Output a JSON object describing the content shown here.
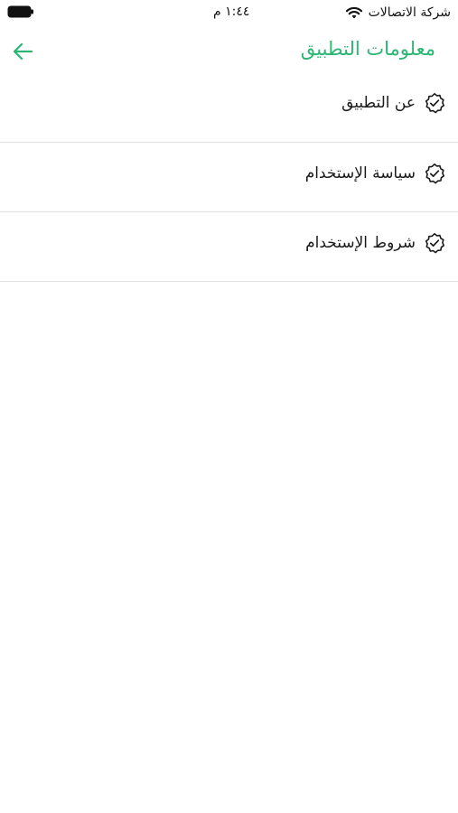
{
  "status_bar": {
    "carrier": "شركة الاتصالات",
    "time": "١:٤٤ م",
    "wifi_icon": "wifi-icon",
    "battery_icon": "battery-icon"
  },
  "header": {
    "title": "معلومات التطبيق",
    "back_icon": "arrow-left-icon"
  },
  "menu": {
    "items": [
      {
        "label": "عن التطبيق",
        "icon": "verified-badge-icon"
      },
      {
        "label": "سياسة الإستخدام",
        "icon": "verified-badge-icon"
      },
      {
        "label": "شروط الإستخدام",
        "icon": "verified-badge-icon"
      }
    ]
  },
  "colors": {
    "accent": "#2bb673",
    "divider": "#e2e2e2",
    "text": "#1a1a1a"
  }
}
